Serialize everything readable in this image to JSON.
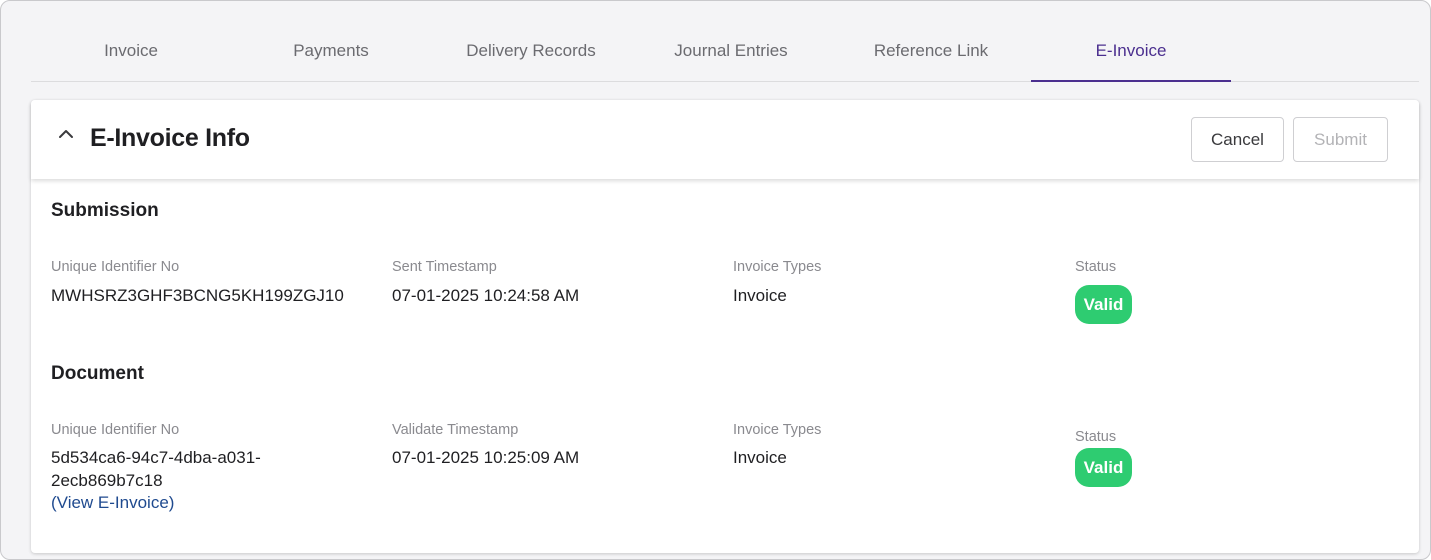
{
  "tabs": [
    {
      "label": "Invoice",
      "active": false
    },
    {
      "label": "Payments",
      "active": false
    },
    {
      "label": "Delivery Records",
      "active": false
    },
    {
      "label": "Journal Entries",
      "active": false
    },
    {
      "label": "Reference Link",
      "active": false
    },
    {
      "label": "E-Invoice",
      "active": true
    }
  ],
  "card": {
    "title": "E-Invoice Info",
    "cancel_label": "Cancel",
    "submit_label": "Submit",
    "collapse_icon": "chevron-up-icon"
  },
  "submission": {
    "title": "Submission",
    "uin_label": "Unique Identifier No",
    "uin_value": "MWHSRZ3GHF3BCNG5KH199ZGJ10",
    "ts_label": "Sent Timestamp",
    "ts_value": "07-01-2025 10:24:58 AM",
    "type_label": "Invoice Types",
    "type_value": "Invoice",
    "status_label": "Status",
    "status_value": "Valid"
  },
  "document": {
    "title": "Document",
    "uin_label": "Unique Identifier No",
    "uin_value_line1": "5d534ca6-94c7-4dba-a031-",
    "uin_value_line2": "2ecb869b7c18",
    "view_link": "(View E-Invoice)",
    "ts_label": "Validate Timestamp",
    "ts_value": "07-01-2025 10:25:09 AM",
    "type_label": "Invoice Types",
    "type_value": "Invoice",
    "status_label": "Status",
    "status_value": "Valid"
  },
  "colors": {
    "accent": "#4b2f8f",
    "valid_badge": "#2ecc71",
    "link": "#1f4a8f"
  }
}
